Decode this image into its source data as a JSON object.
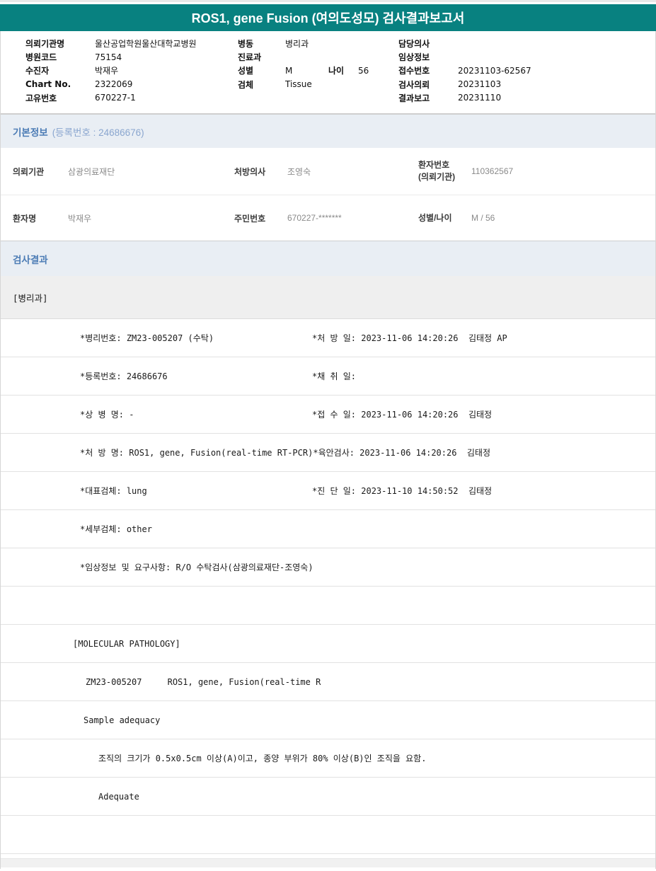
{
  "title": "ROS1, gene Fusion (여의도성모) 검사결과보고서",
  "theme": {
    "title_bar_bg": "#088180",
    "title_text": "#ffffff",
    "section_bar_bg": "#e9eef4",
    "section_title_color": "#4c7cb5",
    "section_subtitle_color": "#8aa6cf",
    "dept_row_bg": "#efefef",
    "footer_bg": "#f1f1f1"
  },
  "patient_header": {
    "left": [
      {
        "label": "의뢰기관명",
        "value": "울산공업학원울산대학교병원"
      },
      {
        "label": "병원코드",
        "value": "75154"
      },
      {
        "label": "수진자",
        "value": "박재우"
      },
      {
        "label": "Chart No.",
        "value": "2322069"
      },
      {
        "label": "고유번호",
        "value": "670227-1"
      }
    ],
    "middle": [
      {
        "label": "병동",
        "value": "병리과"
      },
      {
        "label": "진료과",
        "value": ""
      },
      {
        "label": "성별",
        "value": "M",
        "label2": "나이",
        "value2": "56"
      },
      {
        "label": "검체",
        "value": "Tissue"
      }
    ],
    "right": [
      {
        "label": "담당의사",
        "value": ""
      },
      {
        "label": "임상정보",
        "value": ""
      },
      {
        "label": "접수번호",
        "value": "20231103-62567"
      },
      {
        "label": "검사의뢰",
        "value": "20231103"
      },
      {
        "label": "결과보고",
        "value": "20231110"
      }
    ]
  },
  "basic_info": {
    "section_title": "기본정보",
    "section_subtitle": "(등록번호 : 24686676)",
    "rows": [
      {
        "cells": [
          {
            "label": "의뢰기관",
            "value": "삼광의료재단"
          },
          {
            "label": "처방의사",
            "value": "조영숙"
          },
          {
            "label": "환자번호",
            "label2": "(의뢰기관)",
            "value": "110362567"
          }
        ]
      },
      {
        "cells": [
          {
            "label": "환자명",
            "value": "박재우"
          },
          {
            "label": "주민번호",
            "value": "670227-*******"
          },
          {
            "label": "성별/나이",
            "value": "M / 56"
          }
        ]
      }
    ]
  },
  "results": {
    "section_title": "검사결과",
    "department": "[병리과]",
    "detail_rows": [
      {
        "left": "*병리번호: ZM23-005207 (수탁)",
        "right": "*처 방 일: 2023-11-06 14:20:26  김태정 AP"
      },
      {
        "left": "*등록번호: 24686676",
        "right": "*채 취 일:"
      },
      {
        "left": "*상 병 명: -",
        "right": "*접 수 일: 2023-11-06 14:20:26  김태정"
      },
      {
        "left": "*처 방 명: ROS1, gene, Fusion(real-time RT-PCR)",
        "right": "*육안검사: 2023-11-06 14:20:26  김태정"
      },
      {
        "left": "*대표검체: lung",
        "right": "*진 단 일: 2023-11-10 14:50:52  김태정"
      },
      {
        "left": "*세부검체: other",
        "right": ""
      },
      {
        "left": "*임상정보 및 요구사항: R/O 수탁검사(삼광의료재단-조영숙)",
        "right": ""
      },
      {
        "left": "",
        "right": ""
      },
      {
        "left": "[MOLECULAR PATHOLOGY]",
        "right": ""
      },
      {
        "left": "ZM23-005207     ROS1, gene, Fusion(real-time R",
        "right": ""
      },
      {
        "left": "Sample adequacy",
        "right": ""
      },
      {
        "left": "조직의 크기가 0.5x0.5cm 이상(A)이고, 종양 부위가 80% 이상(B)인 조직을 요함.",
        "right": ""
      },
      {
        "left": "Adequate",
        "right": ""
      },
      {
        "left": "",
        "right": ""
      }
    ]
  }
}
